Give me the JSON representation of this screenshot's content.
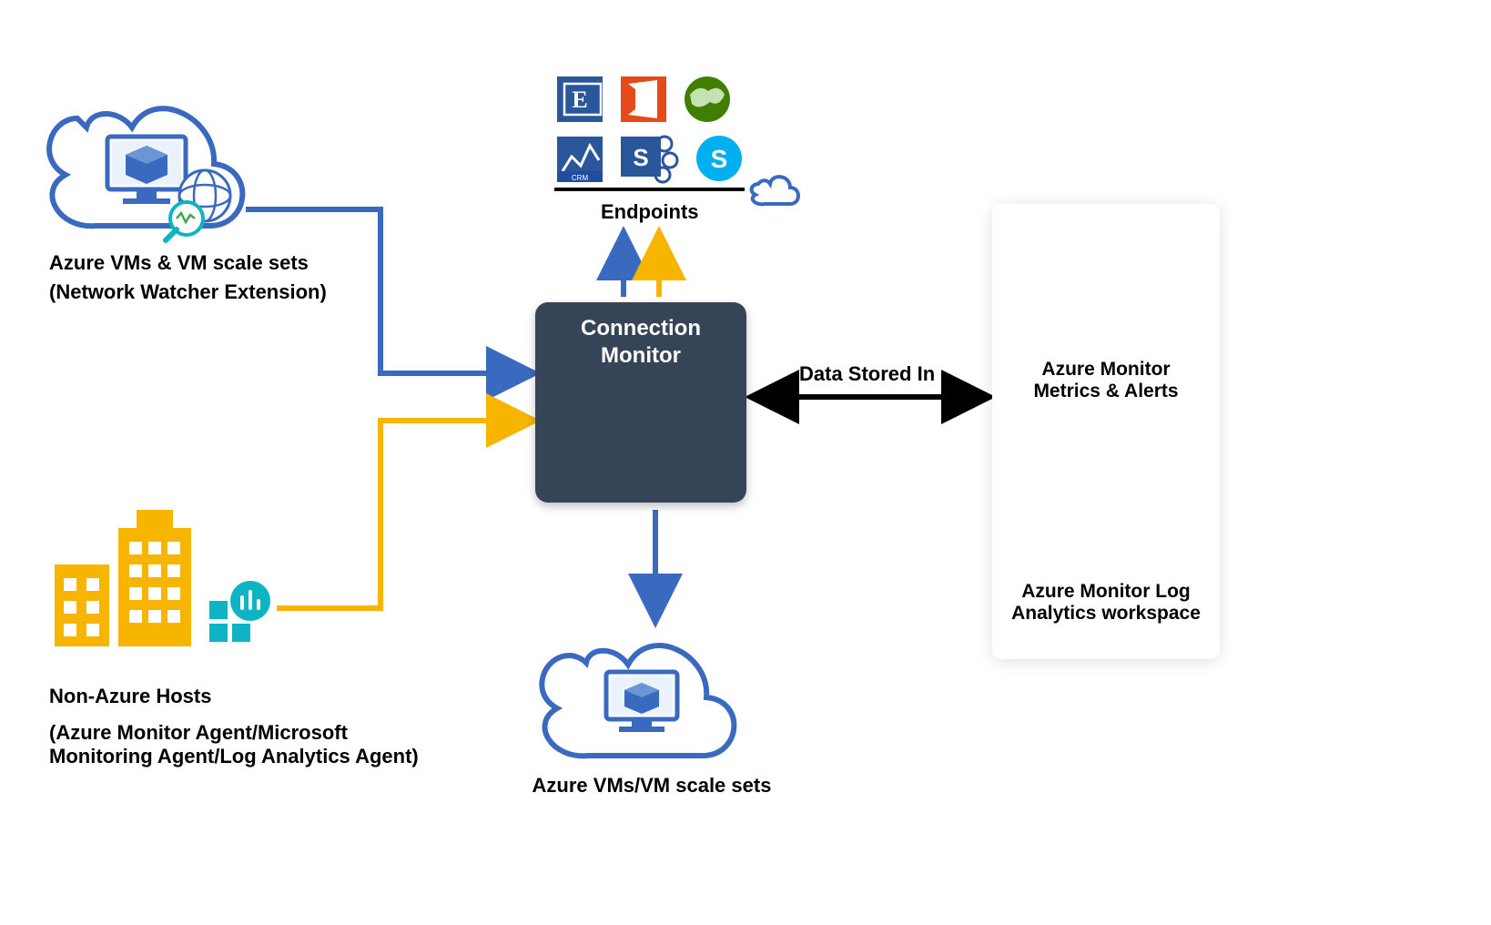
{
  "labels": {
    "azure_vms_top_line1": "Azure VMs & VM scale sets",
    "azure_vms_top_line2": "(Network Watcher Extension)",
    "non_azure_line1": "Non-Azure Hosts",
    "non_azure_line2": "(Azure Monitor Agent/Microsoft Monitoring Agent/Log Analytics Agent)",
    "endpoints": "Endpoints",
    "connection_monitor_line1": "Connection",
    "connection_monitor_line2": "Monitor",
    "azure_vms_bottom": "Azure VMs/VM scale sets",
    "data_stored_in": "Data Stored In",
    "metrics_alerts_line1": "Azure Monitor",
    "metrics_alerts_line2": "Metrics & Alerts",
    "log_analytics_line1": "Azure Monitor Log",
    "log_analytics_line2": "Analytics workspace"
  },
  "icons": {
    "exchange": "exchange-icon",
    "office": "office-icon",
    "globe": "globe-icon",
    "dynamics": "dynamics-crm-icon",
    "sharepoint": "sharepoint-icon",
    "skype": "skype-icon",
    "cloud_small": "cloud-icon",
    "cloud_vm_top": "cloud-vm-icon",
    "network_watcher": "network-watcher-icon",
    "buildings": "buildings-icon",
    "log_analytics_small": "log-analytics-icon",
    "cloud_vm_bottom": "cloud-vm-icon",
    "connection_monitor": "connection-monitor-icon",
    "metrics_chart": "metrics-chart-icon",
    "log_analytics_big": "log-analytics-icon"
  },
  "colors": {
    "azure_blue": "#3a6ac0",
    "azure_dark_blue": "#1e4e9d",
    "orange": "#f5a623",
    "yellow": "#f7b500",
    "teal": "#0fb4c4",
    "box_bg": "#354457",
    "green": "#3f7e00",
    "purple": "#9552d4"
  }
}
